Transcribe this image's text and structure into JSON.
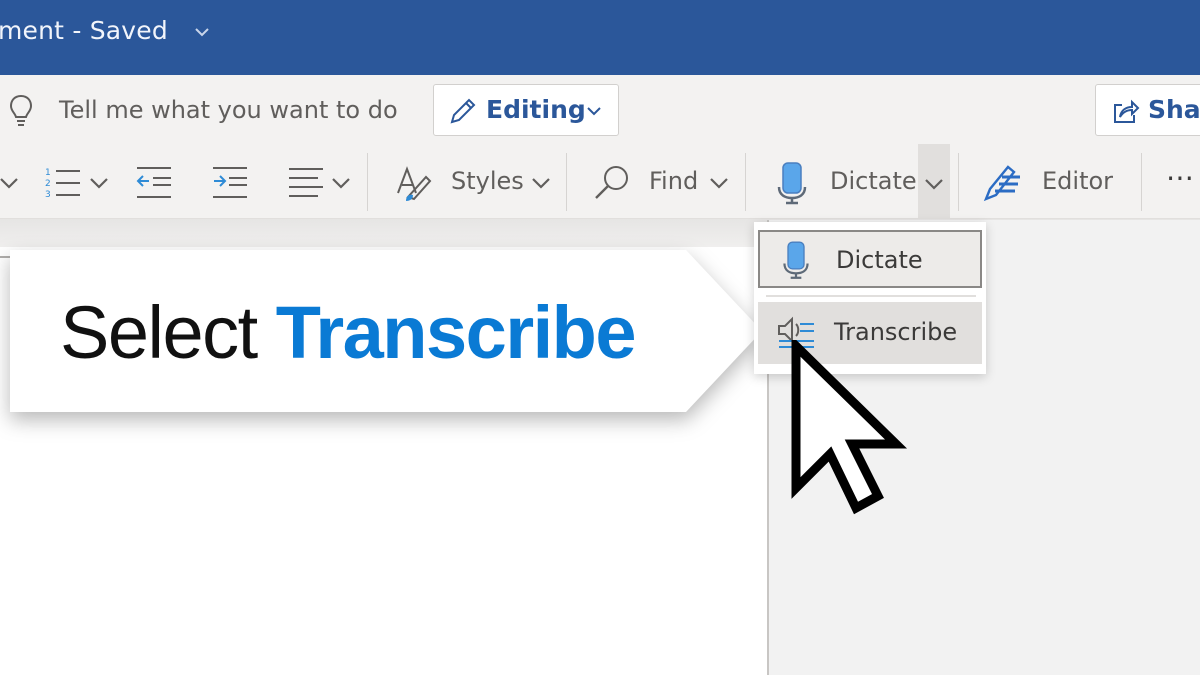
{
  "titlebar": {
    "title": "ment  -  Saved",
    "chevron_icon": "chevron-down-icon"
  },
  "ribbon_top": {
    "search_placeholder": "Tell me what you want to do",
    "search_icon": "lightbulb-icon",
    "mode_button": {
      "label": "Editing",
      "icon": "pencil-icon"
    },
    "share_button": {
      "label": "Share",
      "icon": "share-icon"
    }
  },
  "ribbon": {
    "items": [
      {
        "id": "bullets-dropdown",
        "icon": "chevron-down-icon"
      },
      {
        "id": "numbering",
        "icon": "numbered-list-icon"
      },
      {
        "id": "decrease-indent",
        "icon": "decrease-indent-icon"
      },
      {
        "id": "increase-indent",
        "icon": "increase-indent-icon"
      },
      {
        "id": "align",
        "icon": "align-left-icon"
      },
      {
        "id": "styles",
        "label": "Styles",
        "icon": "styles-icon"
      },
      {
        "id": "find",
        "label": "Find",
        "icon": "search-icon"
      },
      {
        "id": "dictate",
        "label": "Dictate",
        "icon": "microphone-icon"
      },
      {
        "id": "editor",
        "label": "Editor",
        "icon": "editor-icon"
      },
      {
        "id": "more",
        "label": "⋯",
        "icon": "more-icon"
      }
    ]
  },
  "dictate_menu": {
    "items": [
      {
        "label": "Dictate",
        "icon": "microphone-icon",
        "state": "focused"
      },
      {
        "label": "Transcribe",
        "icon": "transcribe-icon",
        "state": "hovered"
      }
    ]
  },
  "callout": {
    "prefix": "Select ",
    "highlight": "Transcribe",
    "highlight_color": "#0a7ad4"
  },
  "colors": {
    "titlebar": "#2b579a",
    "ribbon": "#f3f2f1",
    "accent_blue": "#2b579a"
  }
}
